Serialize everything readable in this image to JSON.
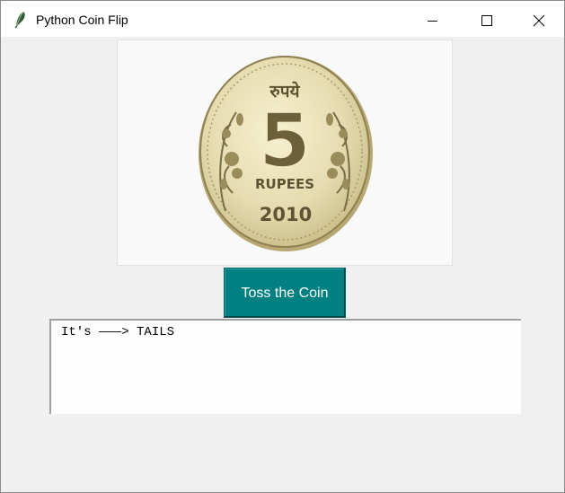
{
  "window": {
    "title": "Python Coin Flip",
    "app_icon": "feather-icon",
    "controls": {
      "minimize_icon": "minimize-icon",
      "maximize_icon": "maximize-icon",
      "close_icon": "close-icon"
    }
  },
  "coin": {
    "top_text": "रुपये",
    "denomination": "5",
    "currency": "RUPEES",
    "year": "2010"
  },
  "toss_button": {
    "label": "Toss the Coin",
    "background": "#008080"
  },
  "result": {
    "text": "It's ———> TAILS"
  }
}
